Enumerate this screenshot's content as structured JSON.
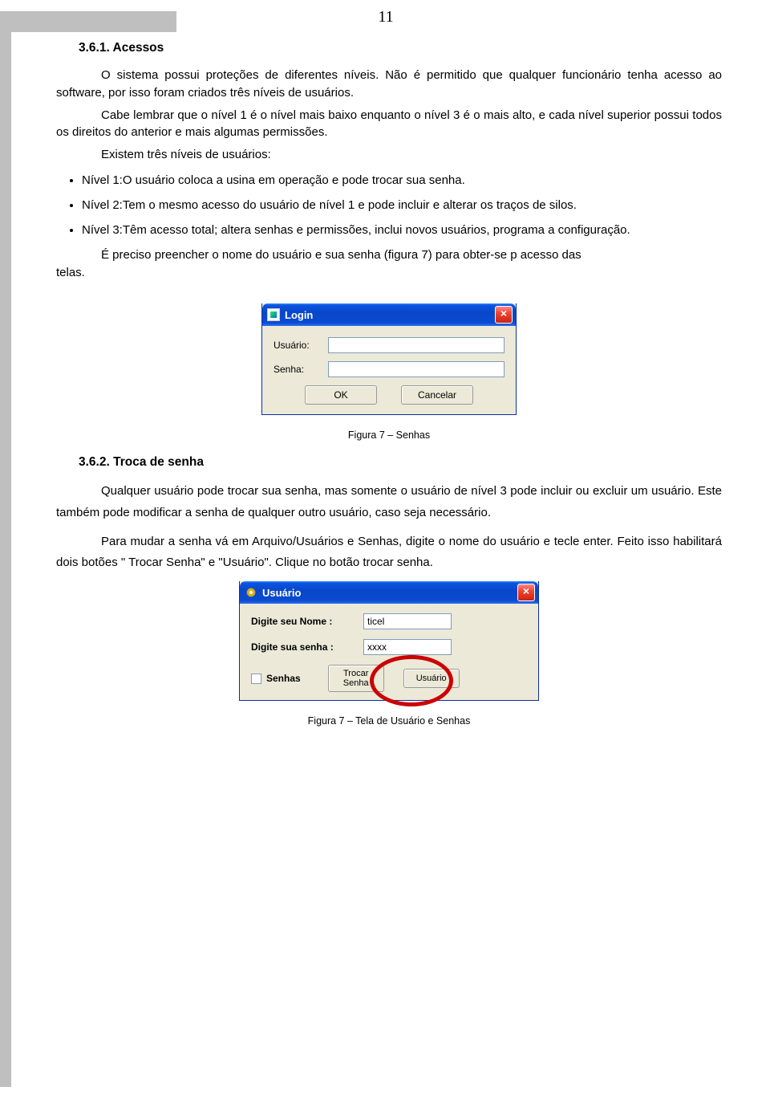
{
  "page_number": "11",
  "section1": {
    "heading": "3.6.1. Acessos",
    "p1": "O sistema possui proteções de diferentes níveis. Não é permitido que qualquer funcionário tenha acesso ao software, por isso foram criados três níveis de usuários.",
    "p2": "Cabe lembrar que o nível 1 é o nível mais baixo enquanto o nível 3 é o mais alto, e cada nível superior possui todos os direitos do anterior e mais algumas permissões.",
    "p3": "Existem três níveis de usuários:",
    "bullets": [
      "Nível 1:O usuário coloca a usina em operação e pode trocar sua senha.",
      "Nível 2:Tem o mesmo acesso do usuário de nível 1 e pode incluir e alterar os traços de silos.",
      "Nível 3:Têm acesso total; altera senhas e permissões, inclui novos usuários, programa a configuração."
    ],
    "p4_part1": "É preciso preencher o nome do usuário e sua senha (figura 7) para obter-se p acesso das",
    "p4_part2": "telas."
  },
  "login_dialog": {
    "title": "Login",
    "label_user": "Usuário:",
    "label_pass": "Senha:",
    "value_user": "",
    "value_pass": "",
    "btn_ok": "OK",
    "btn_cancel": "Cancelar",
    "close_glyph": "×"
  },
  "caption1": "Figura 7 – Senhas",
  "section2": {
    "heading": "3.6.2. Troca de senha",
    "p1": "Qualquer usuário pode trocar sua senha, mas somente o usuário de nível 3 pode incluir ou excluir um usuário. Este também pode modificar a senha de qualquer outro usuário, caso seja necessário.",
    "p2": "Para mudar a senha vá em Arquivo/Usuários e Senhas, digite o nome do usuário e tecle enter. Feito isso habilitará dois botões \" Trocar Senha\" e \"Usuário\". Clique no botão trocar senha."
  },
  "usuario_dialog": {
    "title": "Usuário",
    "label_name": "Digite seu Nome :",
    "label_pass": "Digite sua senha :",
    "value_name": "ticel",
    "value_pass": "xxxx",
    "checkbox_label": "Senhas",
    "btn_trocar_l1": "Trocar",
    "btn_trocar_l2": "Senha",
    "btn_usuario": "Usuário",
    "close_glyph": "×"
  },
  "caption2": "Figura 7 – Tela de Usuário e Senhas"
}
